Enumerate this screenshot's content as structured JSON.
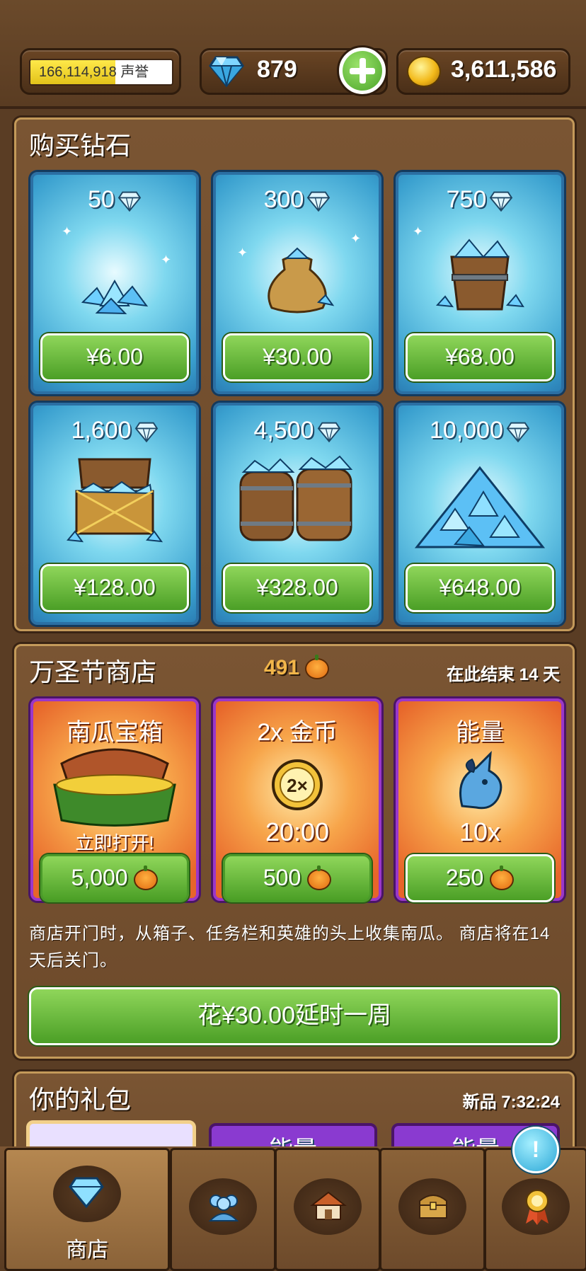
{
  "header": {
    "reputation": "166,114,918",
    "reputation_label": "声誉",
    "gems": "879",
    "gold": "3,611,586"
  },
  "diamond_shop": {
    "title": "购买钻石",
    "items": [
      {
        "amount": "50",
        "price": "¥6.00"
      },
      {
        "amount": "300",
        "price": "¥30.00"
      },
      {
        "amount": "750",
        "price": "¥68.00"
      },
      {
        "amount": "1,600",
        "price": "¥128.00"
      },
      {
        "amount": "4,500",
        "price": "¥328.00"
      },
      {
        "amount": "10,000",
        "price": "¥648.00"
      }
    ]
  },
  "halloween_shop": {
    "title": "万圣节商店",
    "pumpkins": "491",
    "ends_text": "在此结束 14 天",
    "items": [
      {
        "title": "南瓜宝箱",
        "subtitle": "立即打开!",
        "price": "5,000"
      },
      {
        "title": "2x 金币",
        "subtitle": "20:00",
        "price": "500"
      },
      {
        "title": "能量",
        "subtitle": "10x",
        "price": "250"
      }
    ],
    "description": "商店开门时，从箱子、任务栏和英雄的头上收集南瓜。 商店将在14 天后关门。",
    "extend_button": "花¥30.00延时一周"
  },
  "gift_pack": {
    "title": "你的礼包",
    "timer": "新品 7:32:24",
    "items": [
      {
        "title": ""
      },
      {
        "title": "能量"
      },
      {
        "title": "能量"
      }
    ]
  },
  "tabbar": {
    "shop_label": "商店",
    "alert": "!"
  }
}
